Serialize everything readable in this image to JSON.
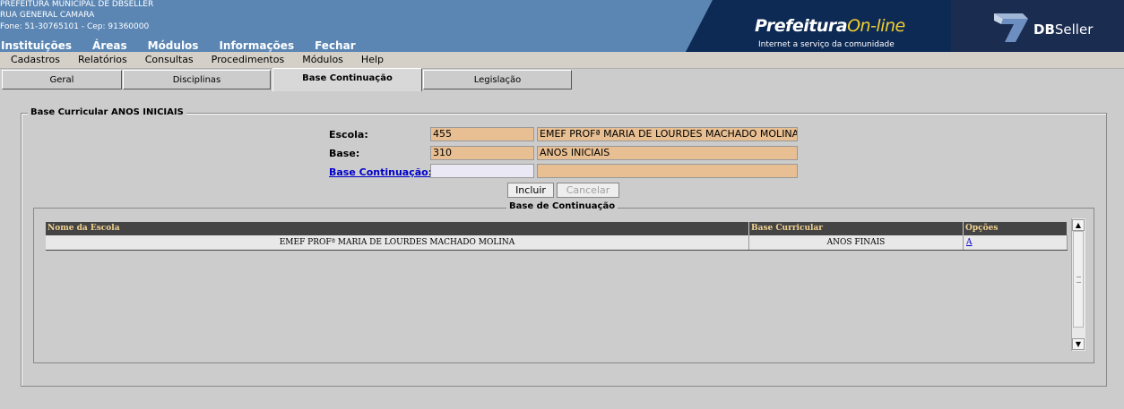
{
  "header": {
    "org_name": "PREFEITURA MUNICIPAL DE DBSELLER",
    "address": "RUA GENERAL CAMARA",
    "contact": "Fone: 51-30765101  -  Cep: 91360000",
    "top_menu": [
      "Instituições",
      "Áreas",
      "Módulos",
      "Informações",
      "Fechar"
    ],
    "brand_main": "Prefeitura",
    "brand_accent": "On-line",
    "brand_tagline": "Internet a serviço da comunidade",
    "dbseller_bold": "DB",
    "dbseller_rest": "Seller"
  },
  "menubar": [
    "Cadastros",
    "Relatórios",
    "Consultas",
    "Procedimentos",
    "Módulos",
    "Help"
  ],
  "tabs": [
    "Geral",
    "Disciplinas",
    "Base Continuação",
    "Legislação"
  ],
  "form": {
    "legend": "Base Curricular ANOS INICIAIS",
    "escola_label": "Escola:",
    "escola_code": "455",
    "escola_name": "EMEF PROFª MARIA DE LOURDES MACHADO MOLINA",
    "base_label": "Base:",
    "base_code": "310",
    "base_name": "ANOS INICIAIS",
    "base_cont_label": "Base Continuação:",
    "base_cont_code": "",
    "base_cont_name": "",
    "incluir": "Incluir",
    "cancelar": "Cancelar"
  },
  "grid": {
    "legend": "Base de Continuação",
    "headers": [
      "Nome da Escola",
      "Base Curricular",
      "Opções"
    ],
    "rows": [
      [
        "EMEF PROFª MARIA DE LOURDES MACHADO MOLINA",
        "ANOS FINAIS",
        "A"
      ]
    ]
  },
  "colors": {
    "header_bg": "#5b86b4",
    "banner_bg": "#0d2a55",
    "field_bg": "#e8bf92",
    "grid_header_bg": "#444444",
    "grid_header_text": "#f1d292"
  }
}
